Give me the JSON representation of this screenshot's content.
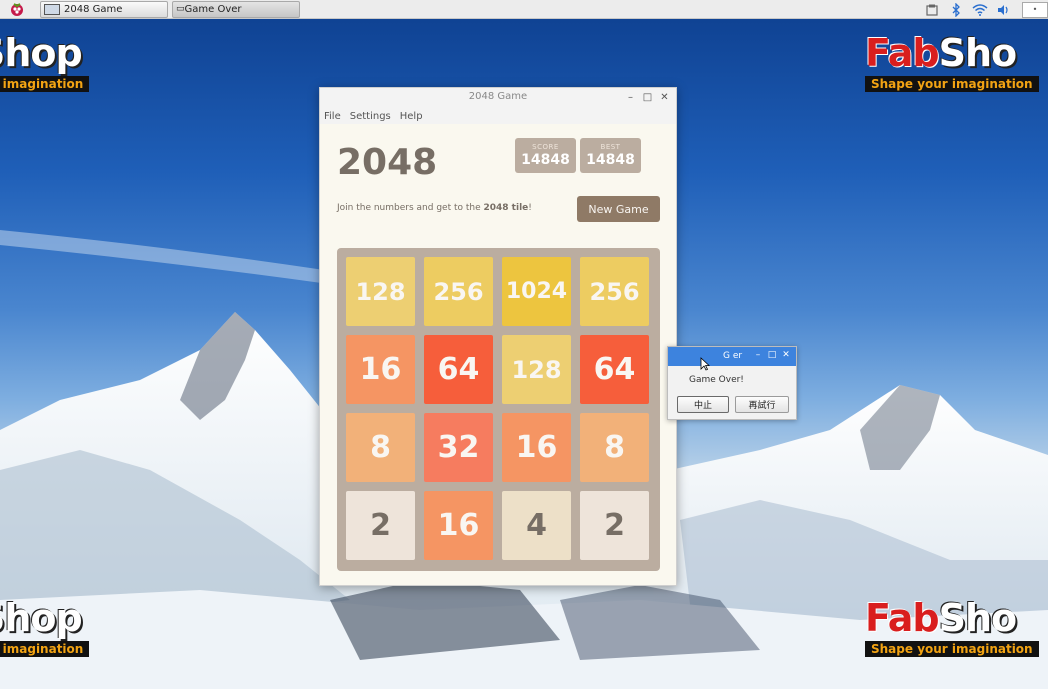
{
  "taskbar": {
    "tasks": [
      {
        "label": "2048 Game"
      },
      {
        "label": "Game Over"
      }
    ],
    "tray_icons": [
      "clipboard-icon",
      "bluetooth-icon",
      "wifi-icon",
      "volume-icon"
    ]
  },
  "watermark": {
    "brand_fab": "Fab",
    "brand_shop": "Shop",
    "tagline": "Shape your imagination",
    "tl_brand": "Shop",
    "tl_tag": "ur imagination",
    "tr_brand_fab": "Fab",
    "tr_brand_shop": "Sho",
    "tr_tag": "Shape your imagination"
  },
  "window": {
    "title": "2048 Game",
    "menu": [
      "File",
      "Settings",
      "Help"
    ]
  },
  "game": {
    "title": "2048",
    "score_label": "SCORE",
    "score": "14848",
    "best_label": "BEST",
    "best": "14848",
    "intro_prefix": "Join the numbers and get to the ",
    "intro_bold": "2048 tile",
    "intro_suffix": "!",
    "new_game_label": "New Game",
    "grid": [
      [
        128,
        256,
        1024,
        256
      ],
      [
        16,
        64,
        128,
        64
      ],
      [
        8,
        32,
        16,
        8
      ],
      [
        2,
        16,
        4,
        2
      ]
    ]
  },
  "dialog": {
    "title": "G   er",
    "message": "Game Over!",
    "abort_label": "中止",
    "retry_label": "再試行"
  },
  "colors": {
    "board": "#bbada0",
    "dialog_title": "#3d83de",
    "button": "#8f7a66"
  }
}
